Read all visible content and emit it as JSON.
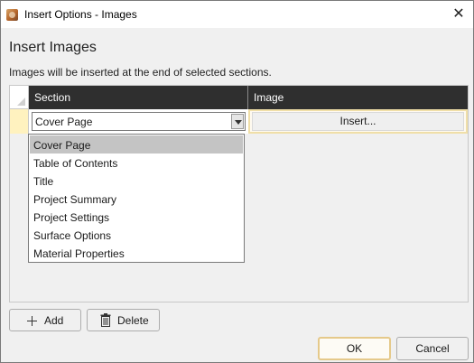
{
  "window": {
    "title": "Insert Options - Images",
    "app_icon": "app-logo-icon",
    "close_symbol": "✕"
  },
  "heading": "Insert Images",
  "description": "Images will be inserted at the end of selected sections.",
  "grid": {
    "columns": [
      "Section",
      "Image"
    ],
    "row": {
      "section_value": "Cover Page",
      "image_button": "Insert..."
    }
  },
  "dropdown": {
    "selected": "Cover Page",
    "options": [
      "Cover Page",
      "Table of Contents",
      "Title",
      "Project Summary",
      "Project Settings",
      "Surface Options",
      "Material Properties"
    ]
  },
  "buttons": {
    "add": "Add",
    "delete": "Delete",
    "ok": "OK",
    "cancel": "Cancel"
  },
  "colors": {
    "header_bg": "#2f2f2f",
    "row_marker": "#fff2bf",
    "selected_item": "#c4c4c4",
    "default_button_border": "#e5c98a"
  }
}
